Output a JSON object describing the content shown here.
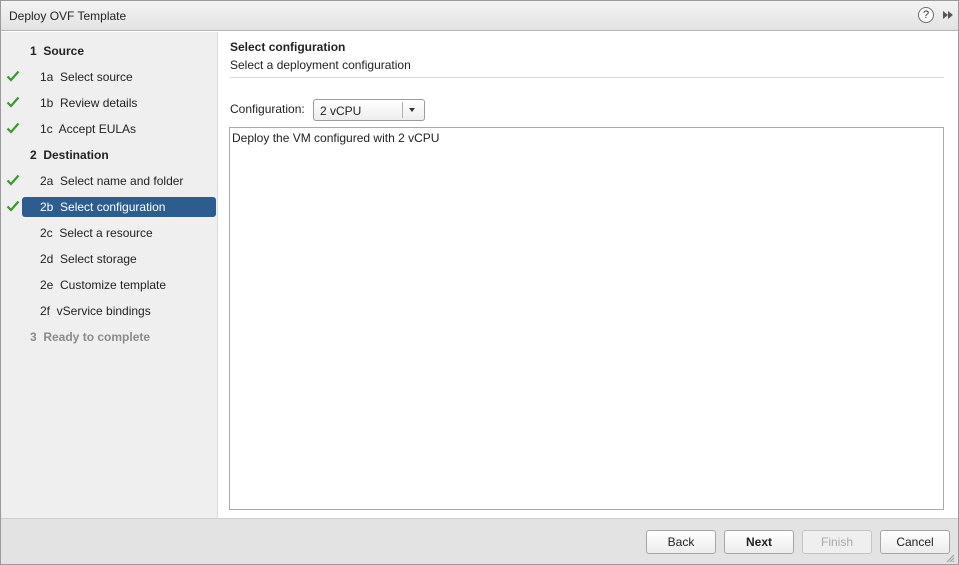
{
  "window": {
    "title": "Deploy OVF Template",
    "help_glyph": "?",
    "icons": {
      "help": "help-icon",
      "expand": "double-chevron-right-icon"
    }
  },
  "steps": [
    {
      "number": "1",
      "label": "Source",
      "type": "group",
      "completed": false,
      "active": false,
      "disabled": false
    },
    {
      "number": "1a",
      "label": "Select source",
      "type": "sub",
      "completed": true,
      "active": false,
      "disabled": false
    },
    {
      "number": "1b",
      "label": "Review details",
      "type": "sub",
      "completed": true,
      "active": false,
      "disabled": false
    },
    {
      "number": "1c",
      "label": "Accept EULAs",
      "type": "sub",
      "completed": true,
      "active": false,
      "disabled": false
    },
    {
      "number": "2",
      "label": "Destination",
      "type": "group",
      "completed": false,
      "active": false,
      "disabled": false
    },
    {
      "number": "2a",
      "label": "Select name and folder",
      "type": "sub",
      "completed": true,
      "active": false,
      "disabled": false
    },
    {
      "number": "2b",
      "label": "Select configuration",
      "type": "sub",
      "completed": true,
      "active": true,
      "disabled": false
    },
    {
      "number": "2c",
      "label": "Select a resource",
      "type": "sub",
      "completed": false,
      "active": false,
      "disabled": false
    },
    {
      "number": "2d",
      "label": "Select storage",
      "type": "sub",
      "completed": false,
      "active": false,
      "disabled": false
    },
    {
      "number": "2e",
      "label": "Customize template",
      "type": "sub",
      "completed": false,
      "active": false,
      "disabled": false
    },
    {
      "number": "2f",
      "label": "vService bindings",
      "type": "sub",
      "completed": false,
      "active": false,
      "disabled": false
    },
    {
      "number": "3",
      "label": "Ready to complete",
      "type": "group",
      "completed": false,
      "active": false,
      "disabled": true
    }
  ],
  "main": {
    "heading": "Select configuration",
    "subheading": "Select a deployment configuration",
    "config_label": "Configuration:",
    "config_value": "2 vCPU",
    "description": "Deploy the VM configured with 2 vCPU"
  },
  "footer": {
    "back": "Back",
    "next": "Next",
    "finish": "Finish",
    "cancel": "Cancel"
  },
  "colors": {
    "active_step_bg": "#2d5c8e",
    "check": "#3a9a2e",
    "sidebar_bg": "#efefef",
    "footer_bg": "#e3e3e3"
  }
}
